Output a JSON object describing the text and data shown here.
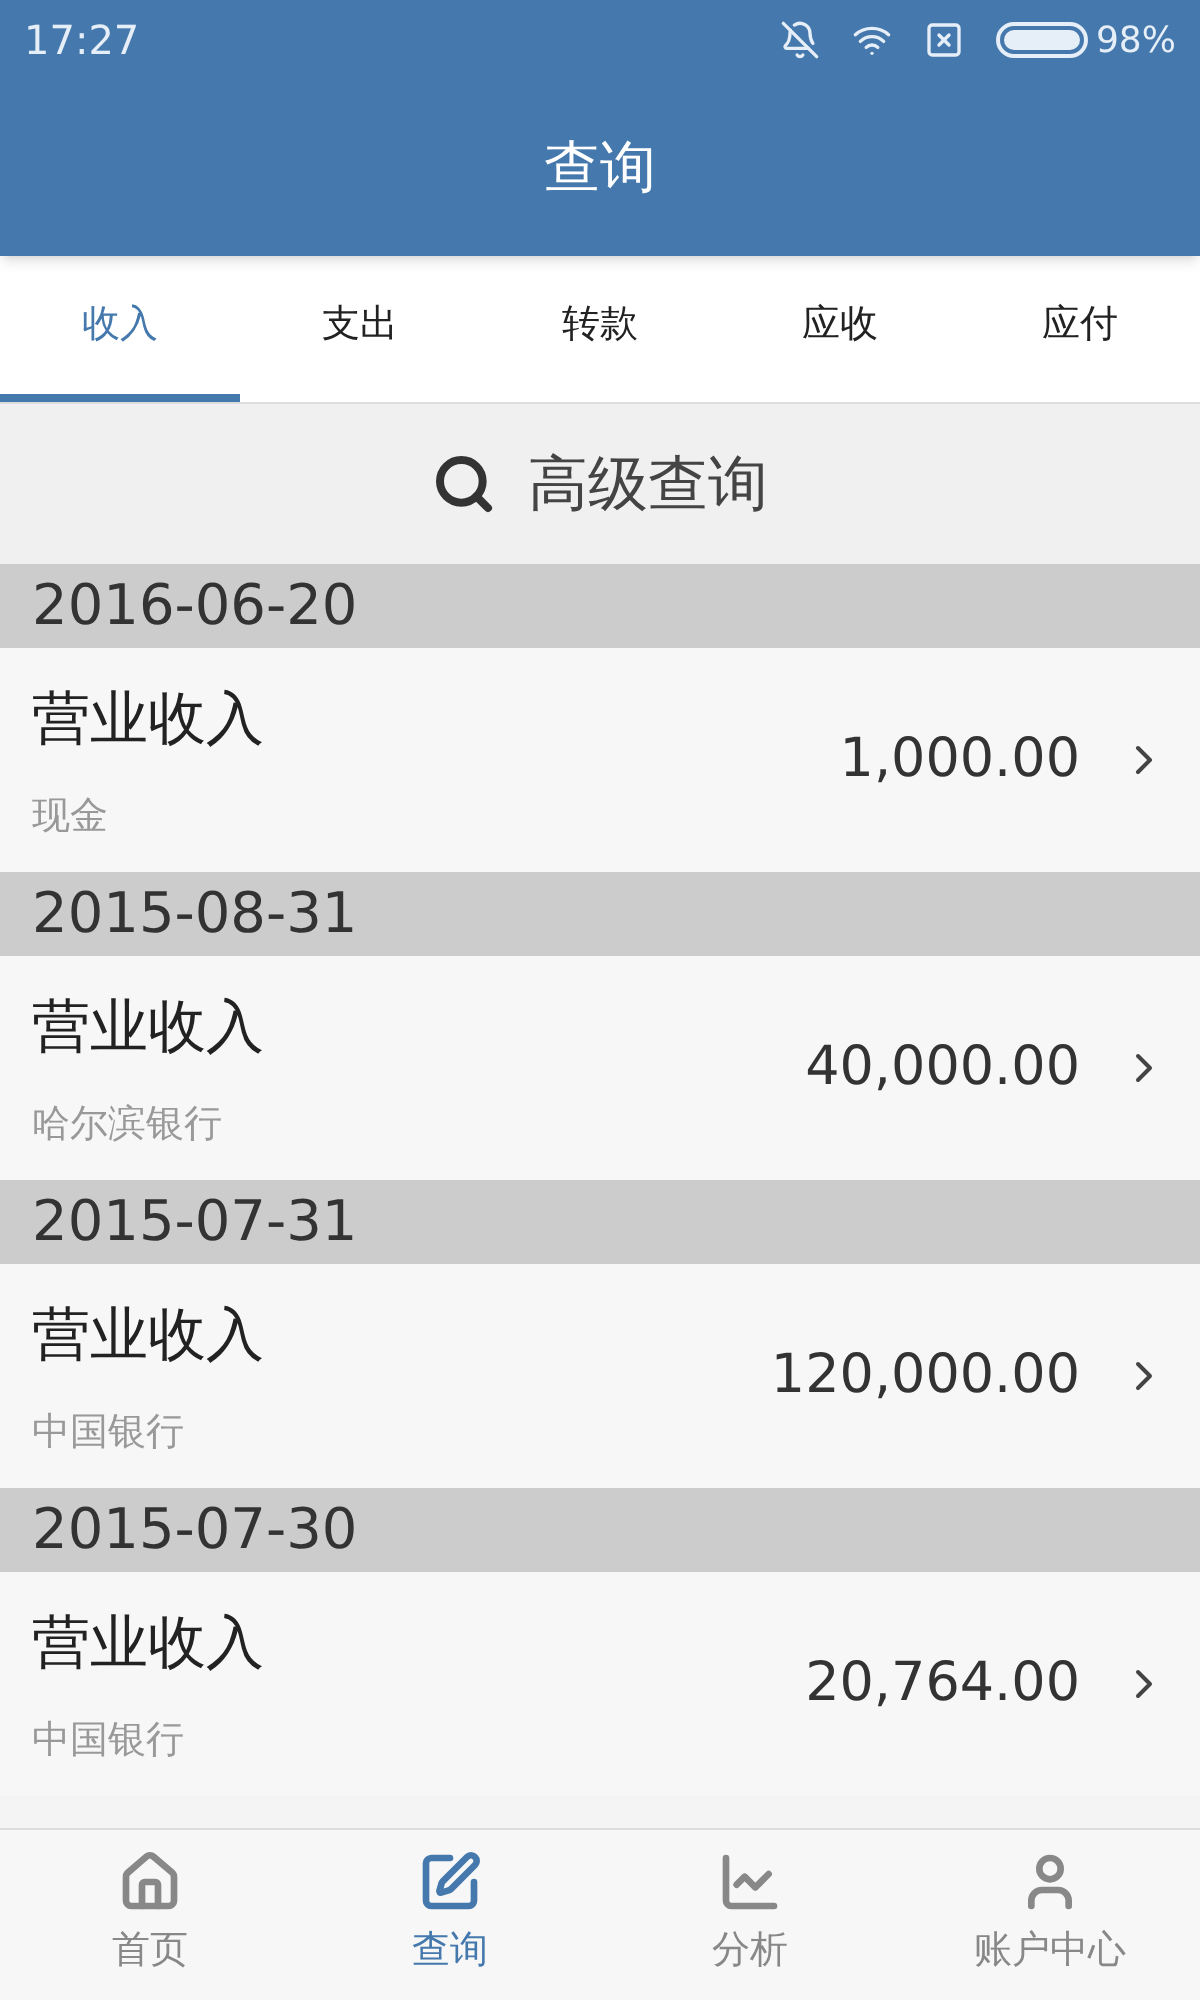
{
  "status_bar": {
    "time": "17:27",
    "battery": "98%"
  },
  "header": {
    "title": "查询"
  },
  "tabs": [
    {
      "label": "收入",
      "selected": true
    },
    {
      "label": "支出",
      "selected": false
    },
    {
      "label": "转款",
      "selected": false
    },
    {
      "label": "应收",
      "selected": false
    },
    {
      "label": "应付",
      "selected": false
    }
  ],
  "search": {
    "label": "高级查询"
  },
  "groups": [
    {
      "date": "2016-06-20",
      "entries": [
        {
          "title": "营业收入",
          "account": "现金",
          "amount": "1,000.00"
        }
      ]
    },
    {
      "date": "2015-08-31",
      "entries": [
        {
          "title": "营业收入",
          "account": "哈尔滨银行",
          "amount": "40,000.00"
        }
      ]
    },
    {
      "date": "2015-07-31",
      "entries": [
        {
          "title": "营业收入",
          "account": "中国银行",
          "amount": "120,000.00"
        }
      ]
    },
    {
      "date": "2015-07-30",
      "entries": [
        {
          "title": "营业收入",
          "account": "中国银行",
          "amount": "20,764.00"
        }
      ]
    }
  ],
  "bottom_nav": [
    {
      "label": "首页",
      "kind": "home",
      "selected": false
    },
    {
      "label": "查询",
      "kind": "query",
      "selected": true
    },
    {
      "label": "分析",
      "kind": "analysis",
      "selected": false
    },
    {
      "label": "账户中心",
      "kind": "account",
      "selected": false
    }
  ]
}
